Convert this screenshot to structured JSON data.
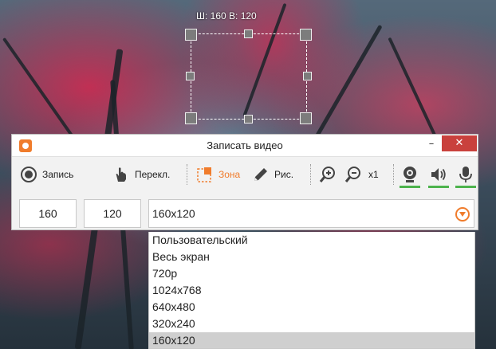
{
  "overlay": {
    "size_label": "Ш: 160 В: 120"
  },
  "window": {
    "title": "Записать видео",
    "minimize_label": "–",
    "close_label": "✕"
  },
  "toolbar": {
    "record_label": "Запись",
    "switch_label": "Перекл.",
    "area_label": "Зона",
    "draw_label": "Рис.",
    "zoom_level": "x1",
    "accent_color": "#f07c2c",
    "active_color": "#4db34d",
    "icons": [
      "record-icon",
      "hand-icon",
      "area-icon",
      "pencil-icon",
      "zoom-in-icon",
      "zoom-out-icon",
      "webcam-icon",
      "speaker-icon",
      "microphone-icon"
    ]
  },
  "size": {
    "width": "160",
    "height": "120",
    "selected": "160x120",
    "options": [
      {
        "label": "Пользовательский",
        "selected": false
      },
      {
        "label": "Весь экран",
        "selected": false
      },
      {
        "label": "720p",
        "selected": false
      },
      {
        "label": "1024x768",
        "selected": false
      },
      {
        "label": "640x480",
        "selected": false
      },
      {
        "label": "320x240",
        "selected": false
      },
      {
        "label": "160x120",
        "selected": true
      }
    ]
  }
}
